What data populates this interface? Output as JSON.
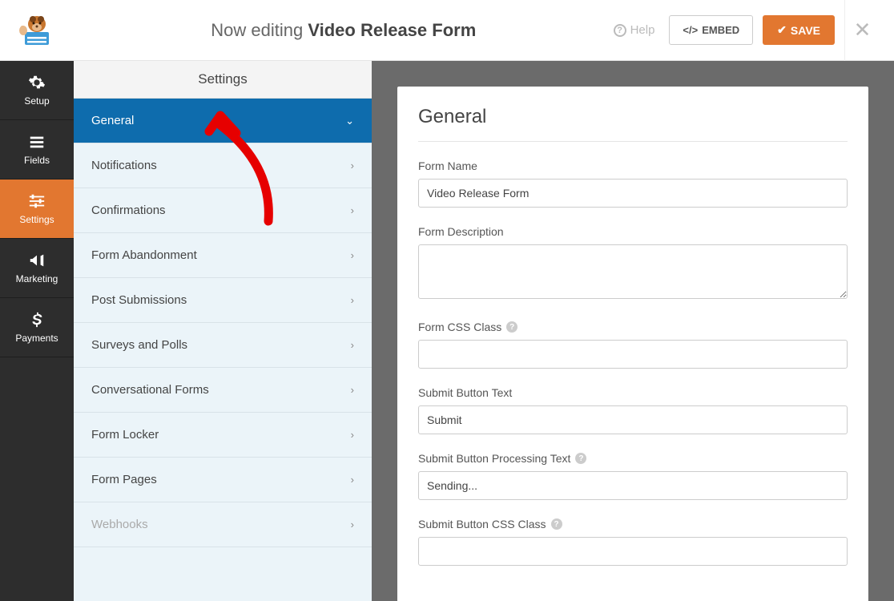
{
  "header": {
    "editing_prefix": "Now editing",
    "form_title": "Video Release Form",
    "help_label": "Help",
    "embed_label": "EMBED",
    "save_label": "SAVE"
  },
  "nav": {
    "items": [
      {
        "label": "Setup",
        "icon": "gear"
      },
      {
        "label": "Fields",
        "icon": "list"
      },
      {
        "label": "Settings",
        "icon": "sliders",
        "active": true
      },
      {
        "label": "Marketing",
        "icon": "bullhorn"
      },
      {
        "label": "Payments",
        "icon": "dollar"
      }
    ]
  },
  "settings_panel": {
    "title": "Settings",
    "items": [
      {
        "label": "General",
        "active": true,
        "chevron": "down"
      },
      {
        "label": "Notifications",
        "chevron": "right"
      },
      {
        "label": "Confirmations",
        "chevron": "right"
      },
      {
        "label": "Form Abandonment",
        "chevron": "right"
      },
      {
        "label": "Post Submissions",
        "chevron": "right"
      },
      {
        "label": "Surveys and Polls",
        "chevron": "right"
      },
      {
        "label": "Conversational Forms",
        "chevron": "right"
      },
      {
        "label": "Form Locker",
        "chevron": "right"
      },
      {
        "label": "Form Pages",
        "chevron": "right"
      },
      {
        "label": "Webhooks",
        "chevron": "right",
        "disabled": true
      }
    ]
  },
  "general_form": {
    "heading": "General",
    "fields": {
      "form_name": {
        "label": "Form Name",
        "value": "Video Release Form"
      },
      "form_description": {
        "label": "Form Description",
        "value": ""
      },
      "form_css_class": {
        "label": "Form CSS Class",
        "value": "",
        "tip": true
      },
      "submit_button_text": {
        "label": "Submit Button Text",
        "value": "Submit"
      },
      "submit_button_processing_text": {
        "label": "Submit Button Processing Text",
        "value": "Sending...",
        "tip": true
      },
      "submit_button_css_class": {
        "label": "Submit Button CSS Class",
        "value": "",
        "tip": true
      }
    }
  },
  "colors": {
    "accent": "#e27730",
    "primary_blue": "#0e6cad",
    "sidebar_bg": "#2d2d2d",
    "annotation_red": "#e60000"
  }
}
